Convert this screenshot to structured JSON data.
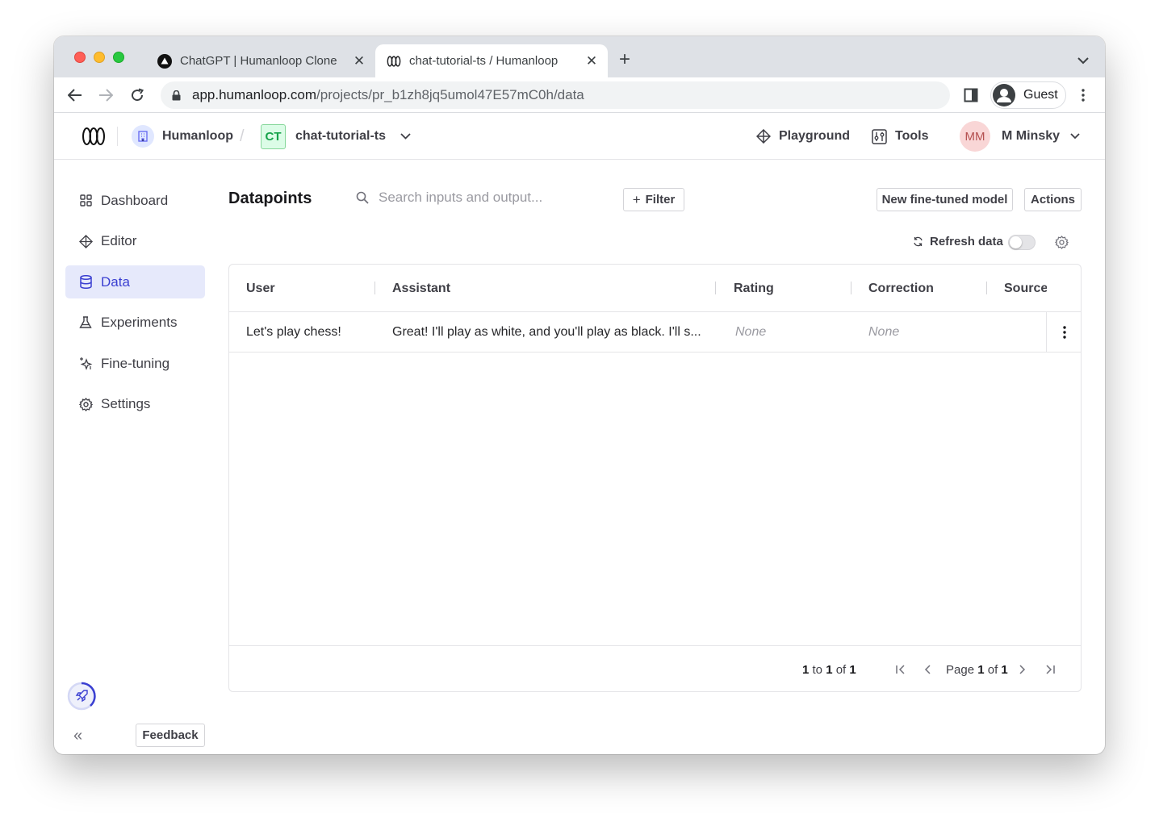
{
  "browser": {
    "tabs": [
      {
        "title": "ChatGPT | Humanloop Clone",
        "active": false
      },
      {
        "title": "chat-tutorial-ts / Humanloop",
        "active": true
      }
    ],
    "url_host": "app.humanloop.com",
    "url_path": "/projects/pr_b1zh8jq5umol47E57mC0h/data",
    "profile_label": "Guest"
  },
  "header": {
    "org_name": "Humanloop",
    "separator": "/",
    "project_badge": "CT",
    "project_name": "chat-tutorial-ts",
    "playground_label": "Playground",
    "tools_label": "Tools",
    "user_initials": "MM",
    "user_name": "M Minsky"
  },
  "sidebar": {
    "items": [
      {
        "label": "Dashboard",
        "icon": "grid-icon",
        "active": false
      },
      {
        "label": "Editor",
        "icon": "diamond-icon",
        "active": false
      },
      {
        "label": "Data",
        "icon": "database-icon",
        "active": true
      },
      {
        "label": "Experiments",
        "icon": "flask-icon",
        "active": false
      },
      {
        "label": "Fine-tuning",
        "icon": "sparkles-icon",
        "active": false
      },
      {
        "label": "Settings",
        "icon": "gear-icon",
        "active": false
      }
    ],
    "feedback_label": "Feedback"
  },
  "main": {
    "title": "Datapoints",
    "search_placeholder": "Search inputs and output...",
    "filter_label": "Filter",
    "new_model_label": "New fine-tuned model",
    "actions_label": "Actions",
    "refresh_label": "Refresh data",
    "refresh_enabled": false,
    "columns": [
      "User",
      "Assistant",
      "Rating",
      "Correction",
      "Source"
    ],
    "rows": [
      {
        "user": "Let's play chess!",
        "assistant": "Great! I'll play as white, and you'll play as black. I'll s...",
        "rating": "None",
        "correction": "None",
        "source": ""
      }
    ],
    "footer": {
      "range_from": "1",
      "range_to_word": "to",
      "range_to": "1",
      "range_of_word": "of",
      "range_total": "1",
      "page_word": "Page",
      "page_current": "1",
      "page_of_word": "of",
      "page_total": "1"
    }
  },
  "colors": {
    "accent": "#3a3fd1",
    "active_bg": "#e6e9fb",
    "project_badge": "#16a34a"
  }
}
